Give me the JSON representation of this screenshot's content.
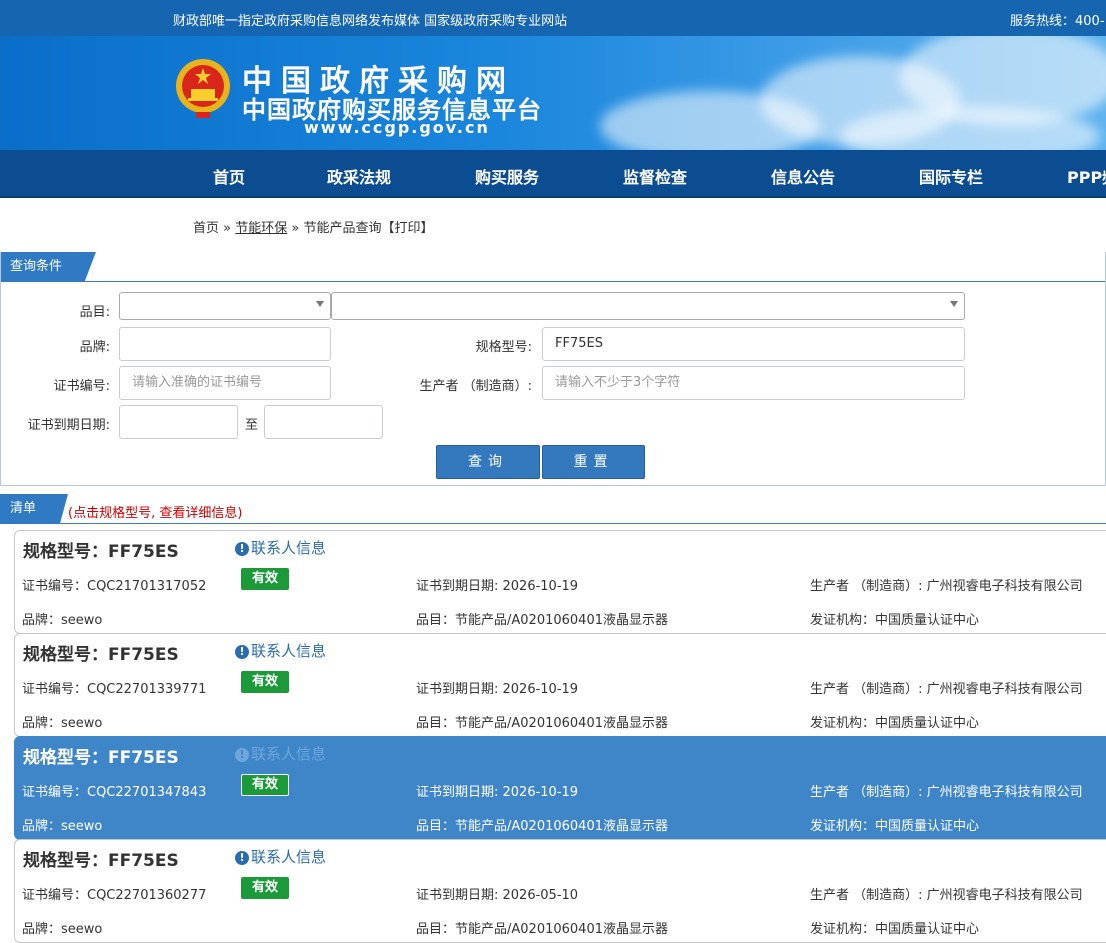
{
  "topbar": {
    "slogan": "财政部唯一指定政府采购信息网络发布媒体 国家级政府采购专业网站",
    "hotline": "服务热线：400-"
  },
  "header": {
    "title_line1": "中国政府采购网",
    "title_line2": "中国政府购买服务信息平台",
    "url": "www.ccgp.gov.cn",
    "emblem_icon": "national-emblem-icon"
  },
  "nav": [
    "首页",
    "政采法规",
    "购买服务",
    "监督检查",
    "信息公告",
    "国际专栏",
    "PPP频"
  ],
  "breadcrumb": {
    "home": "首页",
    "sep1": " » ",
    "section": "节能环保",
    "sep2": " » ",
    "page": "节能产品查询",
    "print": "【打印】"
  },
  "query": {
    "header": "查询条件",
    "category_label": "品目:",
    "brand_label": "品牌:",
    "brand_value": "",
    "model_label": "规格型号:",
    "model_value": "FF75ES",
    "cert_label": "证书编号:",
    "cert_placeholder": "请输入准确的证书编号",
    "maker_label": "生产者 （制造商）:",
    "maker_placeholder": "请输入不少于3个字符",
    "expire_label": "证书到期日期:",
    "to_label": "至",
    "search_button": "查询",
    "reset_button": "重置"
  },
  "list": {
    "header": "清单",
    "hint": "(点击规格型号, 查看详细信息)",
    "contact_label": "联系人信息",
    "items": [
      {
        "model": "规格型号：FF75ES",
        "cert": "证书编号：CQC21701317052",
        "status": "有效",
        "expire": "证书到期日期: 2026-10-19",
        "maker": "生产者 （制造商）: 广州视睿电子科技有限公司",
        "brand": "品牌：seewo",
        "category": "品目：节能产品/A0201060401液晶显示器",
        "issuer": "发证机构：中国质量认证中心"
      },
      {
        "model": "规格型号：FF75ES",
        "cert": "证书编号：CQC22701339771",
        "status": "有效",
        "expire": "证书到期日期: 2026-10-19",
        "maker": "生产者 （制造商）: 广州视睿电子科技有限公司",
        "brand": "品牌：seewo",
        "category": "品目：节能产品/A0201060401液晶显示器",
        "issuer": "发证机构：中国质量认证中心"
      },
      {
        "model": "规格型号：FF75ES",
        "cert": "证书编号：CQC22701347843",
        "status": "有效",
        "expire": "证书到期日期: 2026-10-19",
        "maker": "生产者 （制造商）: 广州视睿电子科技有限公司",
        "brand": "品牌：seewo",
        "category": "品目：节能产品/A0201060401液晶显示器",
        "issuer": "发证机构：中国质量认证中心"
      },
      {
        "model": "规格型号：FF75ES",
        "cert": "证书编号：CQC22701360277",
        "status": "有效",
        "expire": "证书到期日期: 2026-05-10",
        "maker": "生产者 （制造商）: 广州视睿电子科技有限公司",
        "brand": "品牌：seewo",
        "category": "品目：节能产品/A0201060401液晶显示器",
        "issuer": "发证机构：中国质量认证中心"
      }
    ]
  },
  "colors": {
    "brand": "#1565b0",
    "nav": "#0c4d91",
    "accent": "#3479bd",
    "active_row": "#3f86c9",
    "valid": "#1c9a3a",
    "hint": "#d40000"
  }
}
